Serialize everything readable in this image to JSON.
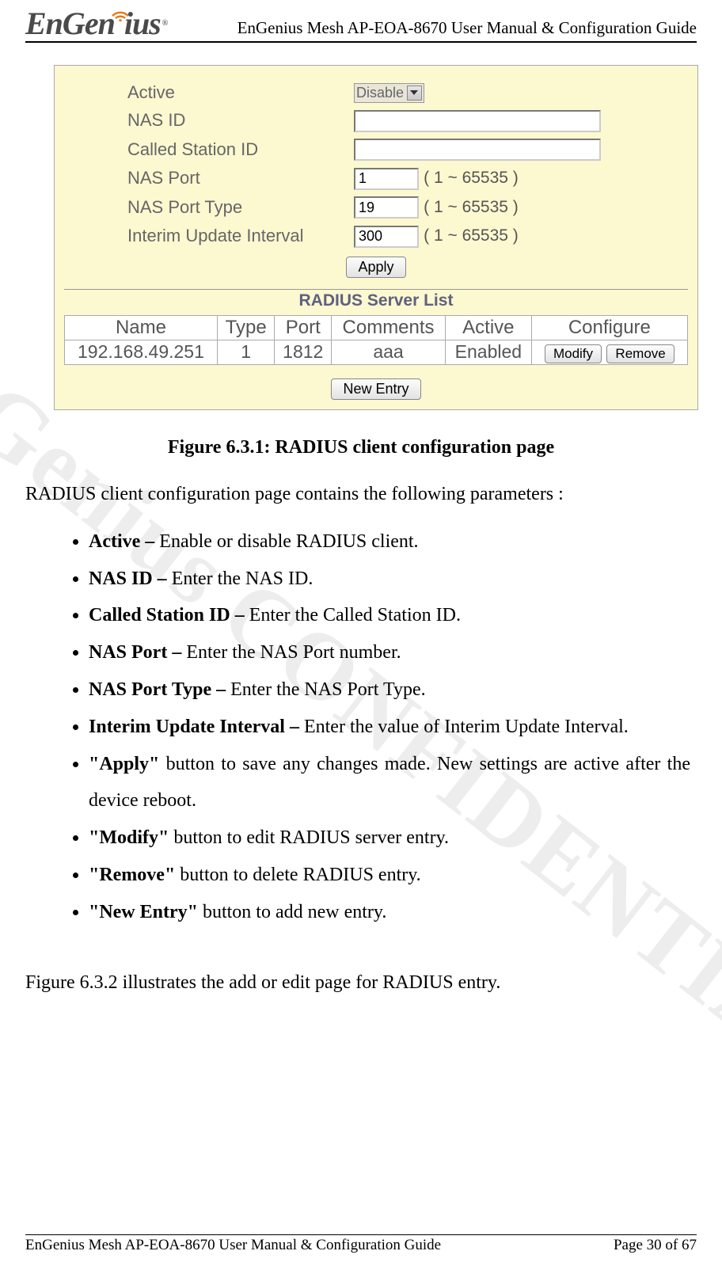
{
  "header": {
    "logo_text_1": "EnGen",
    "logo_text_2": "us",
    "logo_i": "i",
    "logo_tm": "®",
    "title": "EnGenius Mesh AP-EOA-8670 User Manual & Configuration Guide"
  },
  "watermark": "EnGenius CONFIDENTIAL",
  "screenshot": {
    "fields": {
      "active": {
        "label": "Active",
        "value": "Disable"
      },
      "nas_id": {
        "label": "NAS ID",
        "value": ""
      },
      "called_sid": {
        "label": "Called Station ID",
        "value": ""
      },
      "nas_port": {
        "label": "NAS Port",
        "value": "1",
        "range": "( 1 ~ 65535 )"
      },
      "nas_port_type": {
        "label": "NAS Port Type",
        "value": "19",
        "range": "( 1 ~ 65535 )"
      },
      "interim": {
        "label": "Interim Update Interval",
        "value": "300",
        "range": "( 1 ~ 65535 )"
      }
    },
    "apply_btn": "Apply",
    "server_list": {
      "title": "RADIUS Server List",
      "headers": {
        "name": "Name",
        "type": "Type",
        "port": "Port",
        "comments": "Comments",
        "active": "Active",
        "configure": "Configure"
      },
      "row": {
        "name": "192.168.49.251",
        "type": "1",
        "port": "1812",
        "comments": "aaa",
        "active": "Enabled",
        "modify_btn": "Modify",
        "remove_btn": "Remove"
      },
      "new_entry_btn": "New Entry"
    }
  },
  "caption": "Figure 6.3.1: RADIUS client configuration page",
  "intro": "RADIUS client configuration page contains the following parameters :",
  "bullets": [
    {
      "lead": "Active – ",
      "text": "Enable or disable RADIUS client."
    },
    {
      "lead": "NAS ID – ",
      "text": "Enter the NAS ID."
    },
    {
      "lead": "Called Station ID – ",
      "text": "Enter the Called Station ID."
    },
    {
      "lead": "NAS Port – ",
      "text": "Enter the NAS Port number."
    },
    {
      "lead": "NAS Port Type – ",
      "text": "Enter the NAS Port Type."
    },
    {
      "lead": "Interim Update Interval – ",
      "text": "Enter the value of Interim Update Interval."
    },
    {
      "lead": "\"Apply\" ",
      "text": "button to save any changes made. New settings are active after the device reboot."
    },
    {
      "lead": "\"Modify\" ",
      "text": "button to edit RADIUS server entry."
    },
    {
      "lead": "\"Remove\" ",
      "text": "button to delete RADIUS entry."
    },
    {
      "lead": "\"New Entry\" ",
      "text": "button to add new entry."
    }
  ],
  "closing": "Figure 6.3.2 illustrates the add or edit page for RADIUS entry.",
  "footer": {
    "left": "EnGenius Mesh AP-EOA-8670 User Manual & Configuration Guide",
    "right": "Page 30 of 67"
  }
}
